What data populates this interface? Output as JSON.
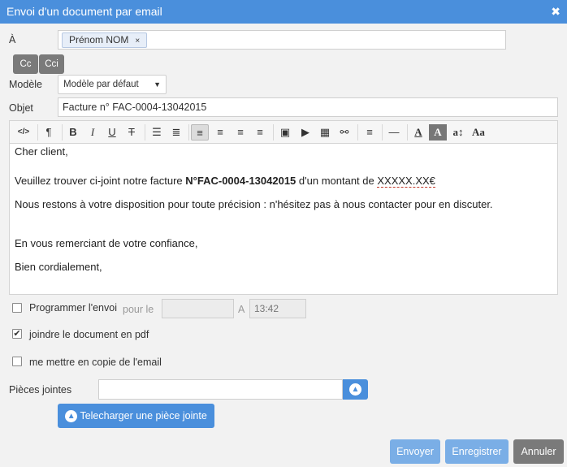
{
  "window": {
    "title": "Envoi d'un document par email",
    "close_glyph": "✖"
  },
  "labels": {
    "to": "À",
    "template": "Modèle",
    "subject": "Objet",
    "attachments": "Pièces jointes",
    "date_prefix": "pour le",
    "time_prefix": "A"
  },
  "recipient": {
    "tag": "Prénom NOM",
    "remove": "×"
  },
  "cc_buttons": {
    "cc": "Cc",
    "cci": "Cci"
  },
  "template_select": {
    "value": "Modèle par défaut"
  },
  "subject_value": "Facture n° FAC-0004-13042015",
  "toolbar_icons": [
    "code-view-icon",
    "paragraph-icon",
    "bold-icon",
    "italic-icon",
    "underline-icon",
    "strikethrough-icon",
    "bullet-list-icon",
    "numbered-list-icon",
    "align-left-icon",
    "align-center-icon",
    "align-right-icon",
    "justify-icon",
    "image-icon",
    "video-icon",
    "table-icon",
    "link-icon",
    "line-height-icon",
    "horizontal-rule-icon",
    "text-color-icon",
    "background-color-icon",
    "font-size-icon",
    "font-family-icon"
  ],
  "body": {
    "greeting": "Cher client,",
    "line1_pre": "Veuillez trouver ci-joint notre facture ",
    "line1_bold": "N°FAC-0004-13042015",
    "line1_mid": " d'un montant de ",
    "line1_amount": "XXXXX.XX€",
    "line2": "Nous restons à votre disposition pour toute précision : n'hésitez pas à nous contacter pour en discuter.",
    "line3": "En vous remerciant de votre confiance,",
    "closing": "Bien cordialement,"
  },
  "options": {
    "schedule": {
      "label": "Programmer l'envoi",
      "checked": false,
      "time": "13:42"
    },
    "attach_pdf": {
      "label": "joindre le document en pdf",
      "checked": true
    },
    "copy_me": {
      "label": "me mettre en copie de l'email",
      "checked": false
    }
  },
  "upload": {
    "button": "Telecharger une pièce jointe",
    "icon": "upload-icon"
  },
  "footer": {
    "send": "Envoyer",
    "save": "Enregistrer",
    "cancel": "Annuler"
  },
  "colors": {
    "accent": "#4a8fdc",
    "grey_button": "#7a7a7a",
    "disabled_blue": "#7aaee6"
  }
}
